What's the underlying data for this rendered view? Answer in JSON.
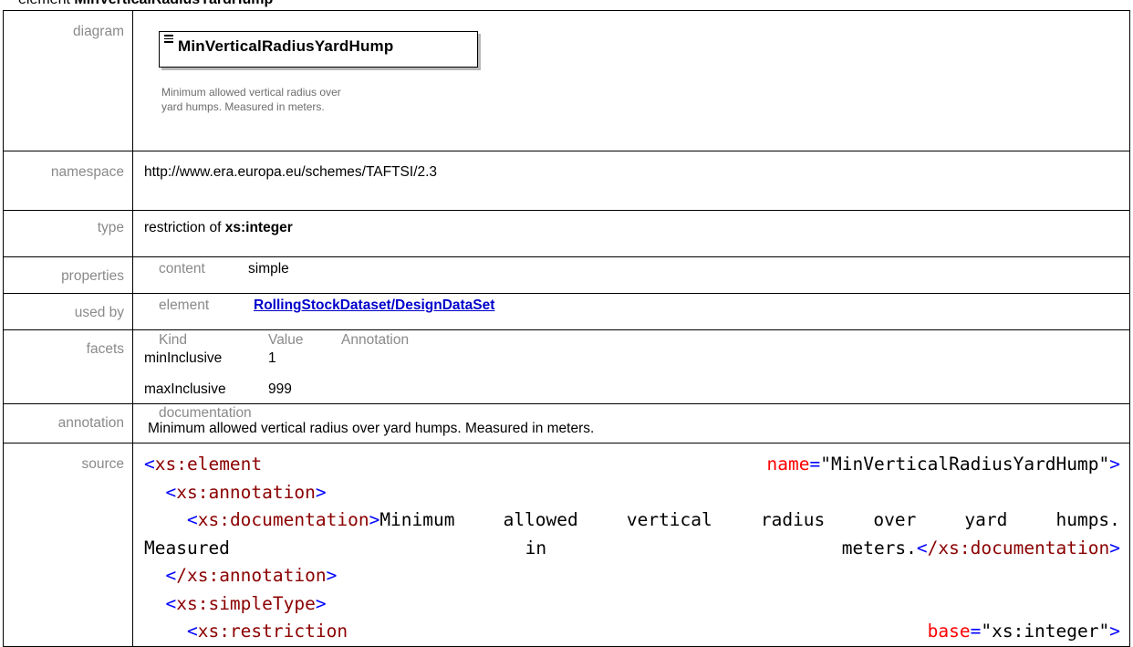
{
  "header": {
    "prefix": "element ",
    "name": "MinVerticalRadiusYardHump"
  },
  "rows": {
    "diagram": {
      "label": "diagram",
      "element_name": "MinVerticalRadiusYardHump",
      "doc_line1": "Minimum allowed vertical radius over",
      "doc_line2": "yard humps. Measured in meters."
    },
    "namespace": {
      "label": "namespace",
      "value": "http://www.era.europa.eu/schemes/TAFTSI/2.3"
    },
    "type": {
      "label": "type",
      "prefix": "restriction of ",
      "base": "xs:integer"
    },
    "properties": {
      "label": "properties",
      "key": "content",
      "value": "simple"
    },
    "used_by": {
      "label": "used by",
      "kind": "element",
      "link": "RollingStockDataset/DesignDataSet"
    },
    "facets": {
      "label": "facets",
      "headers": [
        "Kind",
        "Value",
        "Annotation"
      ],
      "items": [
        {
          "kind": "minInclusive",
          "value": "1"
        },
        {
          "kind": "maxInclusive",
          "value": "999"
        }
      ]
    },
    "annotation": {
      "label": "annotation",
      "sub": "documentation",
      "text": "Minimum allowed vertical radius over yard humps. Measured in meters."
    },
    "source": {
      "label": "source",
      "l1_tag": "xs:element",
      "l1_attr": "name",
      "l1_val": "\"MinVerticalRadiusYardHump\"",
      "l2_tag": "xs:annotation",
      "l3_tag": "xs:documentation",
      "l3_w1": "Minimum",
      "l3_w2": "allowed",
      "l3_w3": "vertical",
      "l3_w4": "radius",
      "l3_w5": "over",
      "l3_w6": "yard",
      "l3_w7": "humps.",
      "l4_w1": "Measured",
      "l4_w2": "in",
      "l4_w3": "meters.",
      "l4_close": "/xs:documentation",
      "l5_close": "/xs:annotation",
      "l6_tag": "xs:simpleType",
      "l7_tag": "xs:restriction",
      "l7_attr": "base",
      "l7_val": "\"xs:integer\""
    }
  }
}
